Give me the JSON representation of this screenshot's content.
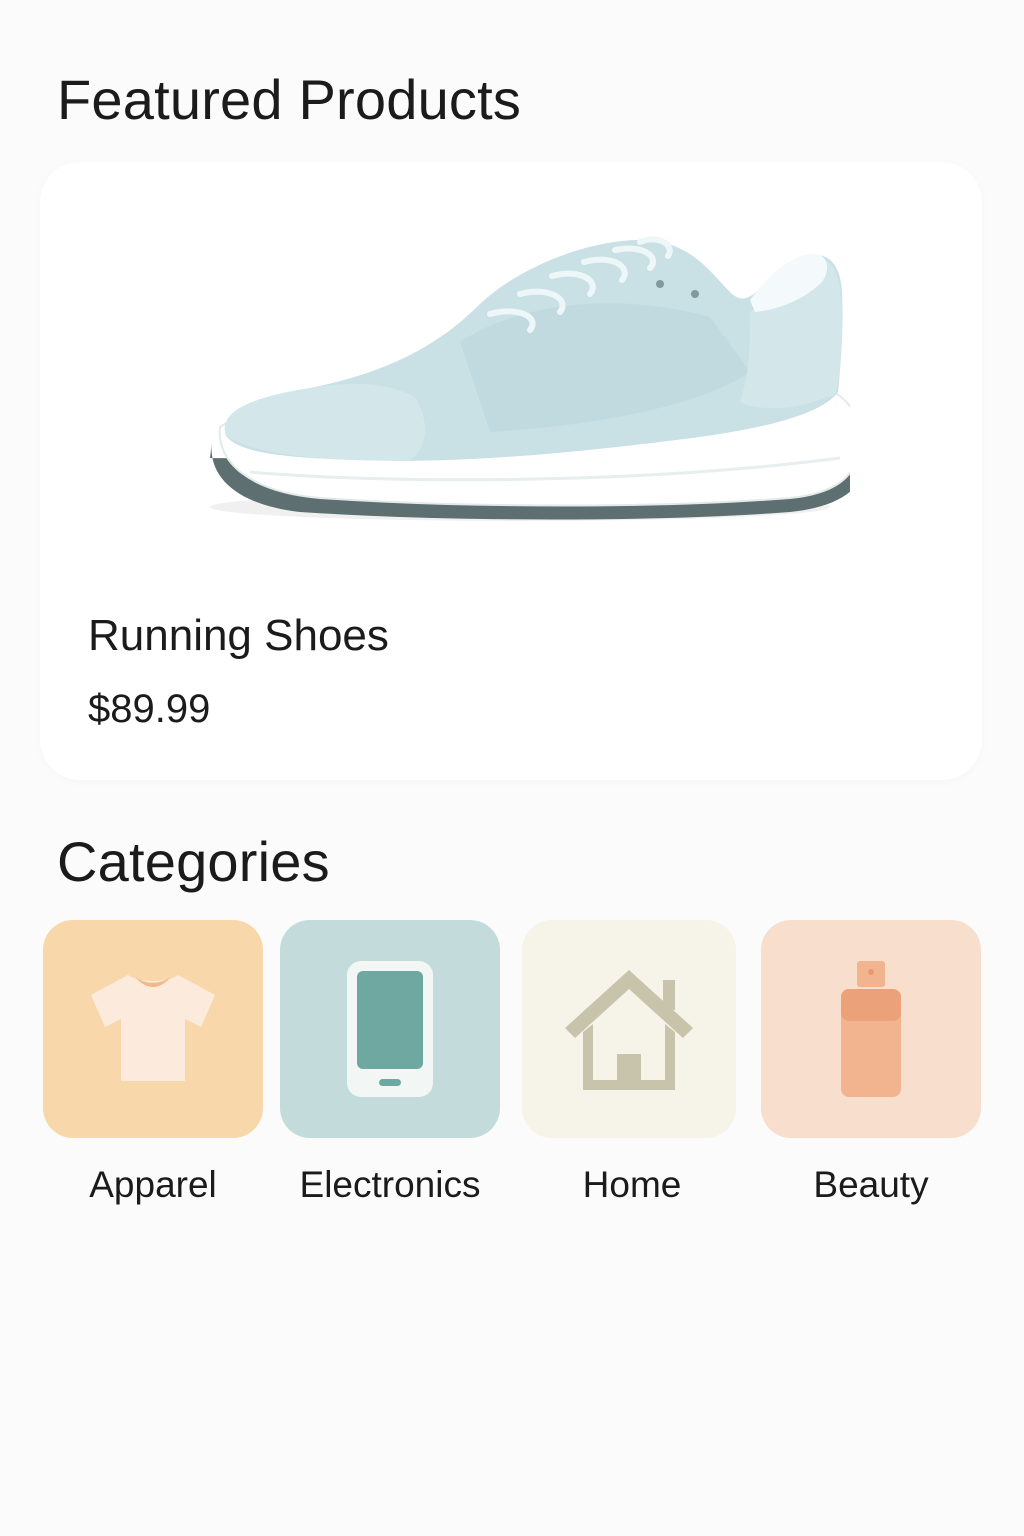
{
  "featured": {
    "title": "Featured Products",
    "product": {
      "name": "Running Shoes",
      "price": "$89.99",
      "image_icon": "running-shoe"
    }
  },
  "categories": {
    "title": "Categories",
    "items": [
      {
        "label": "Apparel",
        "icon": "tshirt-icon",
        "bg": "#f8d7ab",
        "icon_color": "#fcebdc"
      },
      {
        "label": "Electronics",
        "icon": "smartphone-icon",
        "bg": "#c3dcdb",
        "icon_color": "#6fa8a1"
      },
      {
        "label": "Home",
        "icon": "house-icon",
        "bg": "#f6f3e8",
        "icon_color": "#c8c3ab"
      },
      {
        "label": "Beauty",
        "icon": "perfume-bottle-icon",
        "bg": "#f8dfcd",
        "icon_color": "#f1b48e"
      }
    ]
  },
  "colors": {
    "background": "#fbfbfb",
    "card": "#ffffff",
    "text": "#1b1b1b",
    "shoe_upper": "#c9e0e5",
    "shoe_sole": "#ffffff",
    "shoe_outsole": "#5a6e6f"
  }
}
